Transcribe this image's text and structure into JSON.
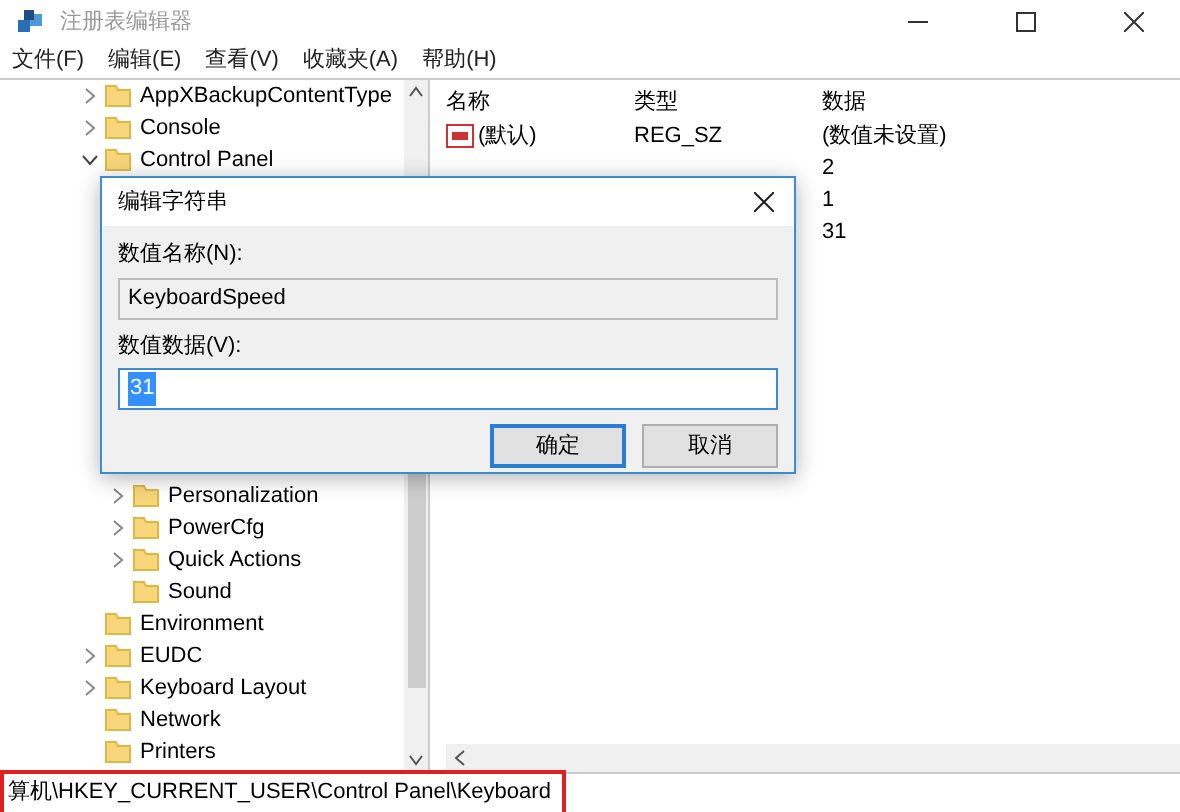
{
  "window": {
    "title": "注册表编辑器"
  },
  "menu": [
    "文件(F)",
    "编辑(E)",
    "查看(V)",
    "收藏夹(A)",
    "帮助(H)"
  ],
  "tree": [
    {
      "label": "AppXBackupContentType",
      "expandable": true,
      "expanded": false
    },
    {
      "label": "Console",
      "expandable": true,
      "expanded": false
    },
    {
      "label": "Control Panel",
      "expandable": true,
      "expanded": true,
      "children": [
        {
          "label": "Personalization",
          "expandable": true,
          "expanded": false
        },
        {
          "label": "PowerCfg",
          "expandable": true,
          "expanded": false
        },
        {
          "label": "Quick Actions",
          "expandable": true,
          "expanded": false
        },
        {
          "label": "Sound",
          "expandable": false
        }
      ]
    },
    {
      "label": "Environment",
      "expandable": false
    },
    {
      "label": "EUDC",
      "expandable": true,
      "expanded": false
    },
    {
      "label": "Keyboard Layout",
      "expandable": true,
      "expanded": false
    },
    {
      "label": "Network",
      "expandable": false
    },
    {
      "label": "Printers",
      "expandable": false
    }
  ],
  "values": {
    "columns": [
      "名称",
      "类型",
      "数据"
    ],
    "rows": [
      {
        "kind": "string",
        "name": "(默认)",
        "type": "REG_SZ",
        "data": "(数值未设置)"
      },
      {
        "kind": "hidden",
        "data": "2"
      },
      {
        "kind": "hidden",
        "data": "1"
      },
      {
        "kind": "hidden",
        "data": "31"
      }
    ]
  },
  "dialog": {
    "title": "编辑字符串",
    "name_label": "数值名称(N):",
    "name_value": "KeyboardSpeed",
    "data_label": "数值数据(V):",
    "data_value": "31",
    "data_selected": true,
    "buttons": [
      {
        "label": "确定",
        "default": true
      },
      {
        "label": "取消",
        "default": false
      }
    ]
  },
  "status_bar": {
    "path": "算机\\HKEY_CURRENT_USER\\Control Panel\\Keyboard",
    "highlighted": true
  }
}
